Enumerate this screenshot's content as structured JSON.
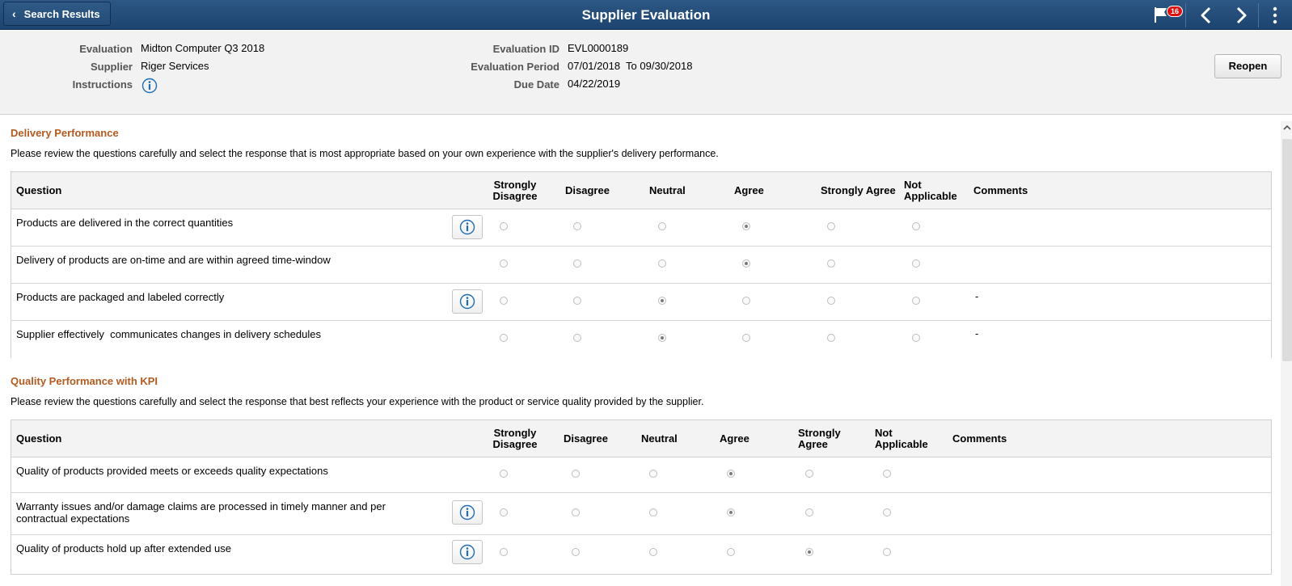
{
  "topbar": {
    "back_label": "Search Results",
    "title": "Supplier Evaluation",
    "notification_count": "16"
  },
  "header": {
    "evaluation_label": "Evaluation",
    "evaluation_value": "Midton Computer Q3 2018",
    "supplier_label": "Supplier",
    "supplier_value": "Riger Services",
    "instructions_label": "Instructions",
    "evaluation_id_label": "Evaluation ID",
    "evaluation_id_value": "EVL0000189",
    "period_label": "Evaluation Period",
    "period_value": "07/01/2018  To 09/30/2018",
    "due_label": "Due Date",
    "due_value": "04/22/2019",
    "reopen_label": "Reopen"
  },
  "sections": [
    {
      "title": "Delivery Performance",
      "description": "Please review the questions carefully and select the response that is most appropriate based on your own experience with the supplier's delivery performance.",
      "headers": {
        "question": "Question",
        "strongly_disagree": [
          "Strongly",
          "Disagree"
        ],
        "disagree": "Disagree",
        "neutral": "Neutral",
        "agree": "Agree",
        "strongly_agree": "Strongly Agree",
        "not_applicable": [
          "Not",
          "Applicable"
        ],
        "comments": "Comments"
      },
      "rows": [
        {
          "question": "Products are delivered in the correct quantities",
          "info": true,
          "selected": "Agree",
          "comment": ""
        },
        {
          "question": "Delivery of products are on-time and are within agreed time-window",
          "info": false,
          "selected": "Agree",
          "comment": ""
        },
        {
          "question": "Products are packaged and labeled correctly",
          "info": true,
          "selected": "Neutral",
          "comment": "-"
        },
        {
          "question": "Supplier effectively  communicates changes in delivery schedules",
          "info": false,
          "selected": "Neutral",
          "comment": "-"
        }
      ]
    },
    {
      "title": "Quality Performance with KPI",
      "description": "Please review the questions carefully and select the response that best reflects your experience with the product or service quality provided by the supplier.",
      "headers": {
        "question": "Question",
        "strongly_disagree": [
          "Strongly",
          "Disagree"
        ],
        "disagree": "Disagree",
        "neutral": "Neutral",
        "agree": "Agree",
        "strongly_agree": [
          "Strongly",
          "Agree"
        ],
        "not_applicable": [
          "Not",
          "Applicable"
        ],
        "comments": "Comments"
      },
      "rows": [
        {
          "question": "Quality of products provided meets or exceeds quality expectations",
          "info": false,
          "selected": "Agree",
          "comment": ""
        },
        {
          "question": "Warranty issues and/or damage claims are processed in timely manner and per",
          "question_line2": "contractual expectations",
          "info": true,
          "selected": "Agree",
          "comment": ""
        },
        {
          "question": "Quality of products hold up after extended use",
          "info": true,
          "selected": "Strongly Agree",
          "comment": ""
        }
      ]
    }
  ],
  "colors": {
    "topbar": "#1f4a77",
    "section_title": "#b25a1f",
    "header_bg": "#f2f2f2",
    "info_icon": "#1f6eb5"
  },
  "icons": [
    "chevron-left-icon",
    "flag-icon",
    "prev-icon",
    "next-icon",
    "more-icon",
    "info-icon",
    "scroll-up-icon"
  ]
}
